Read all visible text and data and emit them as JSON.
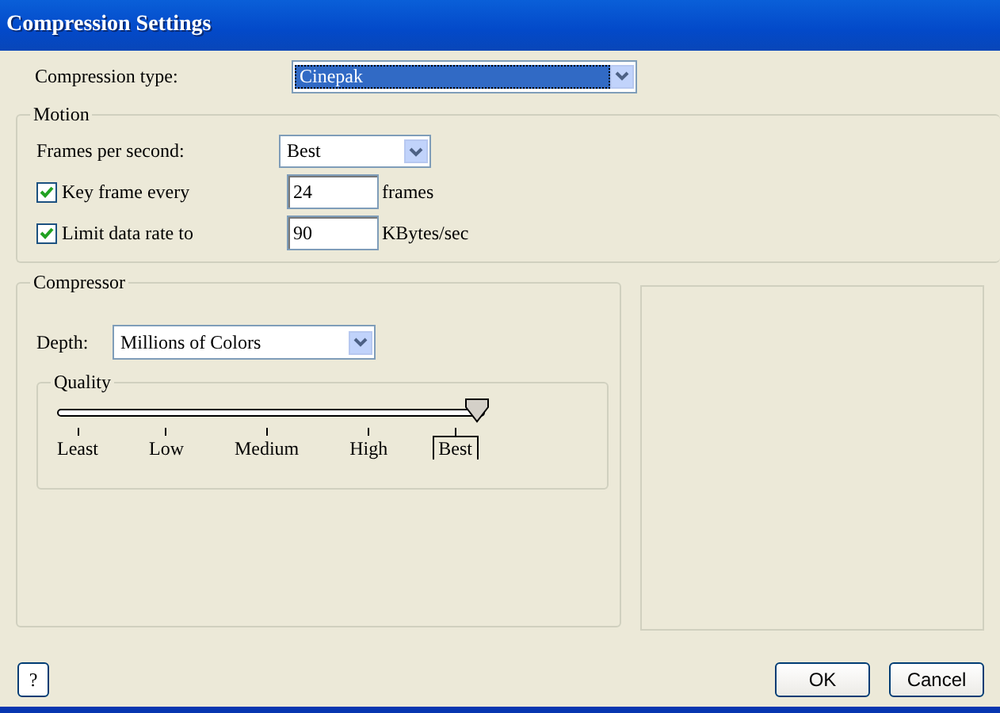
{
  "window": {
    "title": "Compression Settings"
  },
  "compression_type": {
    "label": "Compression type:",
    "value": "Cinepak"
  },
  "motion": {
    "title": "Motion",
    "fps": {
      "label": "Frames per second:",
      "value": "Best"
    },
    "options": [
      {
        "label": "Key frame every",
        "checked": true,
        "value": "24",
        "unit": "frames"
      },
      {
        "label": "Limit data rate to",
        "checked": true,
        "value": "90",
        "unit": "KBytes/sec"
      }
    ]
  },
  "compressor": {
    "title": "Compressor",
    "depth": {
      "label": "Depth:",
      "value": "Millions of Colors"
    },
    "quality": {
      "title": "Quality",
      "level": 1,
      "ticks": [
        {
          "label": "Least",
          "selected": false
        },
        {
          "label": "Low",
          "selected": false
        },
        {
          "label": "Medium",
          "selected": false
        },
        {
          "label": "High",
          "selected": false
        },
        {
          "label": "Best",
          "selected": true
        }
      ]
    }
  },
  "help_button": "?",
  "buttons": [
    "OK",
    "Cancel"
  ]
}
